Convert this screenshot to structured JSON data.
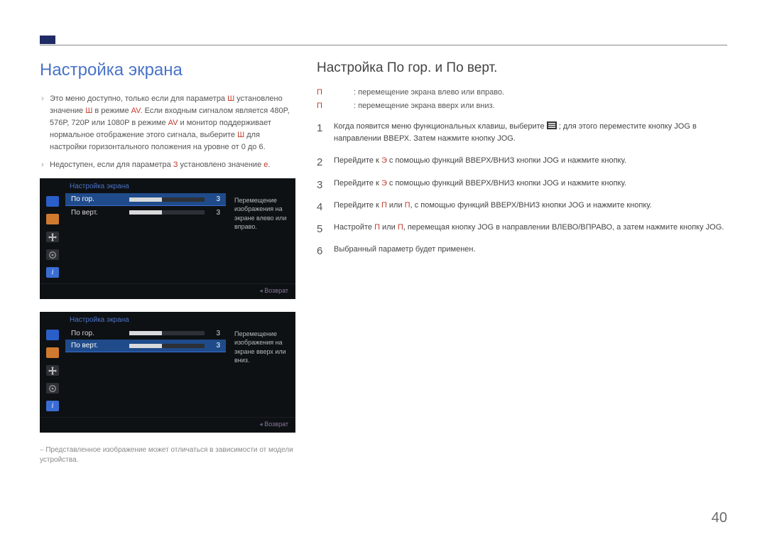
{
  "section_title": "Настройка экрана",
  "notes": [
    {
      "pre": "Это меню доступно, только если для параметра ",
      "hl1": "Ш",
      "mid1": " установлено значение ",
      "hl2": "Ш",
      "mid2": " в режиме ",
      "hl3": "AV",
      "after": ". Если входным сигналом является 480P, 576P, 720P или 1080P в режиме ",
      "hl4": "AV",
      "after2": " и монитор поддерживает нормальное отображение этого сигнала, выберите ",
      "hl5": "Ш",
      "after3": " для настройки горизонтального положения на уровне от 0 до 6."
    },
    {
      "pre": "Недоступен, если для параметра ",
      "hl1": "З",
      "mid1": " установлено значение ",
      "hl2": "е",
      "after": "."
    }
  ],
  "osd": {
    "title": "Настройка экрана",
    "row_h": {
      "label": "По гор.",
      "value": "3"
    },
    "row_v": {
      "label": "По верт.",
      "value": "3"
    },
    "desc_h": "Перемещение изображения на экране влево или вправо.",
    "desc_v": "Перемещение изображения на экране вверх или вниз.",
    "return": "Возврат",
    "icons": [
      "display-icon",
      "picture-icon",
      "move-icon",
      "gear-icon",
      "info-icon"
    ]
  },
  "footnote": "Представленное изображение может отличаться в зависимости от модели устройства.",
  "sub_title": "Настройка По гор. и По верт.",
  "defs": {
    "h": {
      "label": "П",
      "text": ": перемещение экрана влево или вправо."
    },
    "v": {
      "label": "П",
      "text": ": перемещение экрана вверх или вниз."
    }
  },
  "steps": [
    {
      "pre": "Когда появится меню функциональных клавиш, выберите ",
      "post": " ; для этого переместите кнопку JOG в направлении ВВЕРХ. Затем нажмите кнопку JOG."
    },
    {
      "pre": "Перейдите к ",
      "hl1": "Э",
      "post": " с помощью функций ВВЕРХ/ВНИЗ кнопки JOG и нажмите кнопку."
    },
    {
      "pre": "Перейдите к ",
      "hl1": "Э",
      "post": " с помощью функций ВВЕРХ/ВНИЗ кнопки JOG и нажмите кнопку."
    },
    {
      "pre": "Перейдите к ",
      "hl1": "П",
      "mid": " или ",
      "hl2": "П",
      "post": ", с помощью функций ВВЕРХ/ВНИЗ кнопки JOG и нажмите кнопку."
    },
    {
      "pre": "Настройте ",
      "hl1": "П",
      "mid": " или ",
      "hl2": "П",
      "post": ", перемещая кнопку JOG в направлении ВЛЕВО/ВПРАВО, а затем нажмите кнопку JOG."
    },
    {
      "pre": "Выбранный параметр будет применен."
    }
  ],
  "page_number": "40"
}
